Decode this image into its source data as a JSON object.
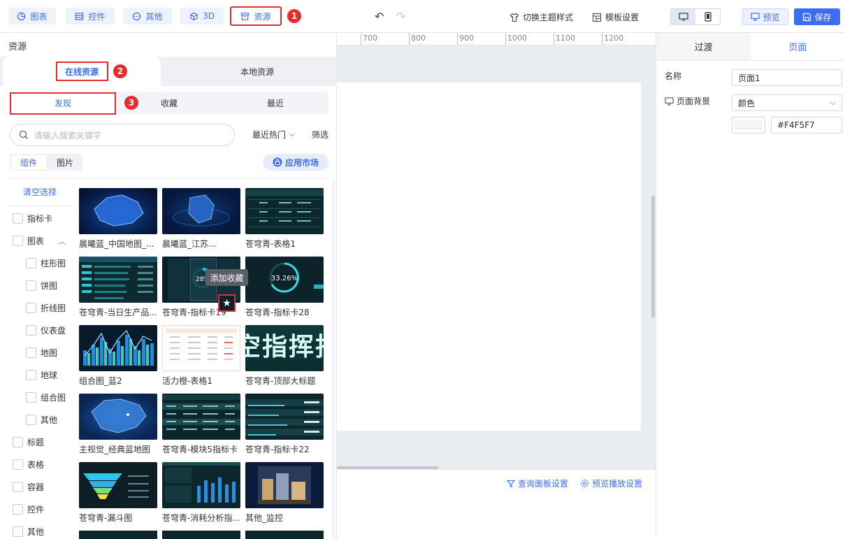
{
  "toolbar": {
    "chart": "图表",
    "widget": "控件",
    "other": "其他",
    "threeD": "3D",
    "resource": "资源",
    "theme": "切换主题样式",
    "template": "模板设置",
    "preview": "预览",
    "save": "保存"
  },
  "badges": [
    "1",
    "2",
    "3"
  ],
  "ruler": [
    "700",
    "800",
    "900",
    "1000",
    "1100",
    "1200"
  ],
  "left": {
    "title": "资源",
    "tabs": [
      "在线资源",
      "本地资源"
    ],
    "subtabs": [
      "发现",
      "收藏",
      "最近"
    ],
    "search_placeholder": "请输入搜索关键字",
    "sort": "最近热门",
    "filter": "筛选",
    "types": [
      "组件",
      "图片"
    ],
    "market": "应用市场",
    "clear": "清空选择",
    "categories": [
      "指标卡",
      "图表",
      "柱形图",
      "饼图",
      "折线图",
      "仪表盘",
      "地图",
      "地球",
      "组合图",
      "其他",
      "标题",
      "表格",
      "容器",
      "控件",
      "其他"
    ],
    "tooltip": "添加收藏",
    "cards": [
      "晨曦蓝_中国地图_...",
      "晨曦蓝_江苏...",
      "苍穹青-表格1",
      "苍穹青-当日生产品...",
      "苍穹青-指标卡19",
      "苍穹青-指标卡28",
      "组合图_蓝2",
      "活力橙-表格1",
      "苍穹青-顶部大标题",
      "主视觉_经典蓝地图",
      "苍穹青-模块5指标卡",
      "苍穹青-指标卡22",
      "苍穹青-漏斗图",
      "苍穹青-消耗分析指...",
      "其他_监控"
    ],
    "thumb_text": {
      "pct1": "28%",
      "pct2": "33.26%",
      "big_title": "空指挥拄"
    }
  },
  "bottom": {
    "query": "查询面板设置",
    "play": "预览播放设置"
  },
  "right": {
    "tabs": [
      "过渡",
      "页面"
    ],
    "name_label": "名称",
    "name_value": "页面1",
    "bg_label": "页面背景",
    "bg_type": "颜色",
    "bg_color": "#F4F5F7"
  }
}
